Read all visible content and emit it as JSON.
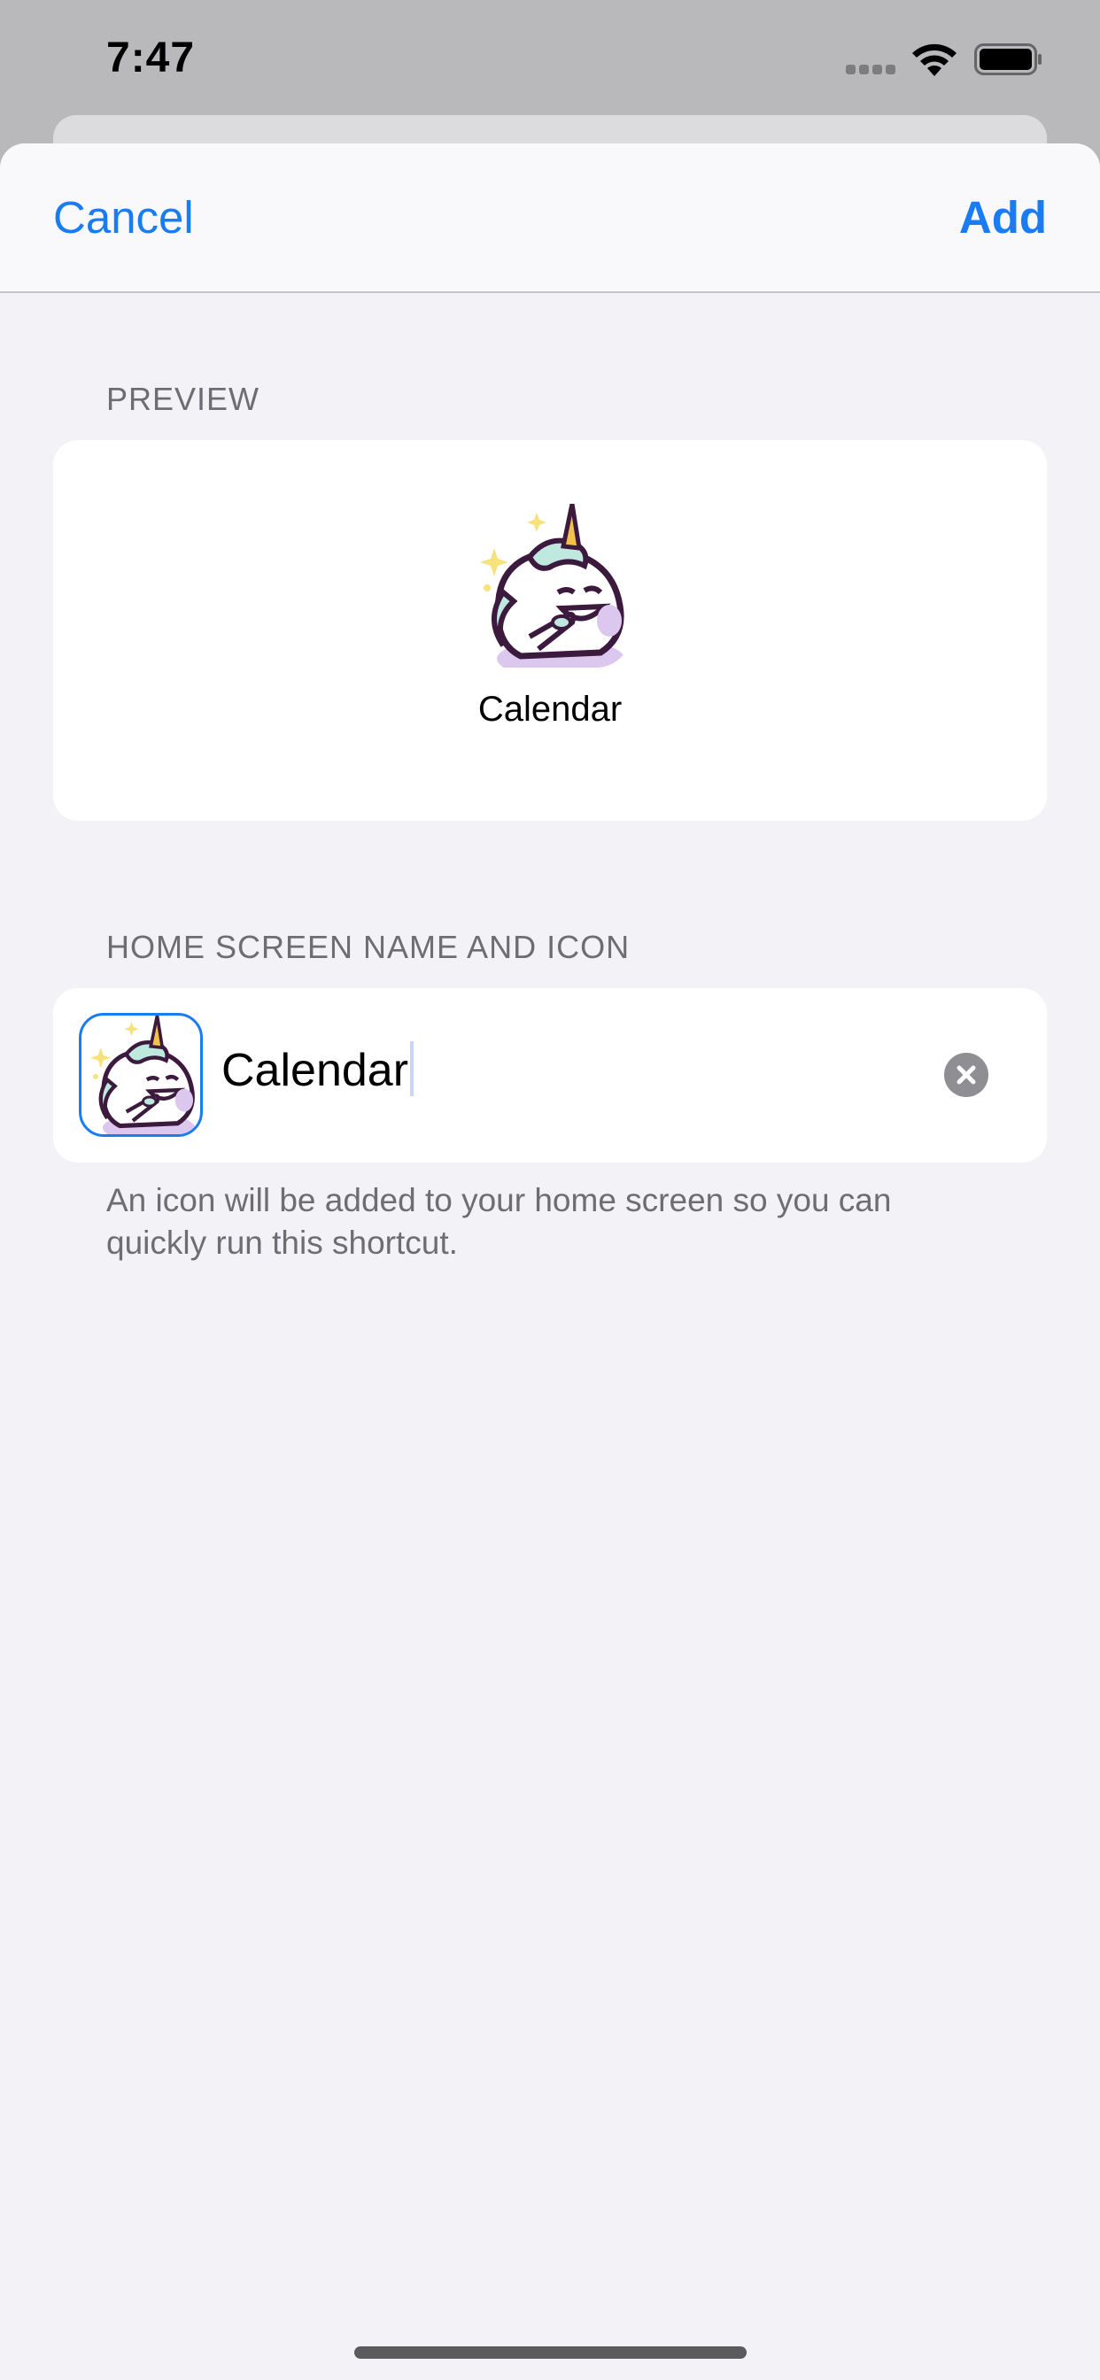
{
  "status_bar": {
    "time": "7:47",
    "signal_icon": "signal-icon",
    "wifi_icon": "wifi-icon",
    "battery_icon": "battery-icon"
  },
  "nav": {
    "cancel_label": "Cancel",
    "add_label": "Add"
  },
  "preview": {
    "header": "PREVIEW",
    "icon": "unicorn-icon",
    "label": "Calendar"
  },
  "name_section": {
    "header": "HOME SCREEN NAME AND ICON",
    "icon": "unicorn-icon",
    "value": "Calendar",
    "clear_icon": "clear-icon",
    "footer": "An icon will be added to your home screen so you can quickly run this shortcut."
  },
  "colors": {
    "accent": "#1a7cf2",
    "background": "#f2f2f7",
    "secondary_text": "#6d6d72"
  }
}
